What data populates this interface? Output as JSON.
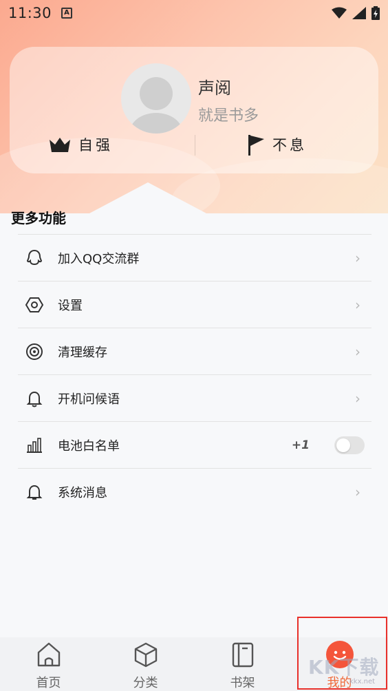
{
  "status_bar": {
    "time": "11:30",
    "notification_icon": "a-badge-icon",
    "icons": [
      "wifi-icon",
      "signal-icon",
      "battery-charging-icon"
    ]
  },
  "profile": {
    "name": "声阅",
    "subtitle": "就是书多",
    "stat_left": "自强",
    "stat_right": "不息"
  },
  "section": {
    "title": "更多功能"
  },
  "menu": [
    {
      "label": "加入QQ交流群",
      "icon": "qq-icon"
    },
    {
      "label": "设置",
      "icon": "hexagon-settings-icon"
    },
    {
      "label": "清理缓存",
      "icon": "target-icon"
    },
    {
      "label": "开机问候语",
      "icon": "bell-icon"
    },
    {
      "label": "电池白名单",
      "icon": "bar-chart-icon",
      "badge": "+1",
      "toggle": false
    },
    {
      "label": "系统消息",
      "icon": "bell-outline-icon"
    }
  ],
  "tabs": [
    {
      "label": "首页",
      "icon": "home-icon"
    },
    {
      "label": "分类",
      "icon": "cube-icon"
    },
    {
      "label": "书架",
      "icon": "book-icon"
    },
    {
      "label": "我的",
      "icon": "smile-ball-icon",
      "active": true
    }
  ],
  "watermark": {
    "text": "KK下载",
    "url": "kkx.net"
  },
  "colors": {
    "accent": "#f06a3a",
    "hero_start": "#fba98f",
    "hero_end": "#fbe2c6",
    "highlight_border": "#e8302a"
  }
}
